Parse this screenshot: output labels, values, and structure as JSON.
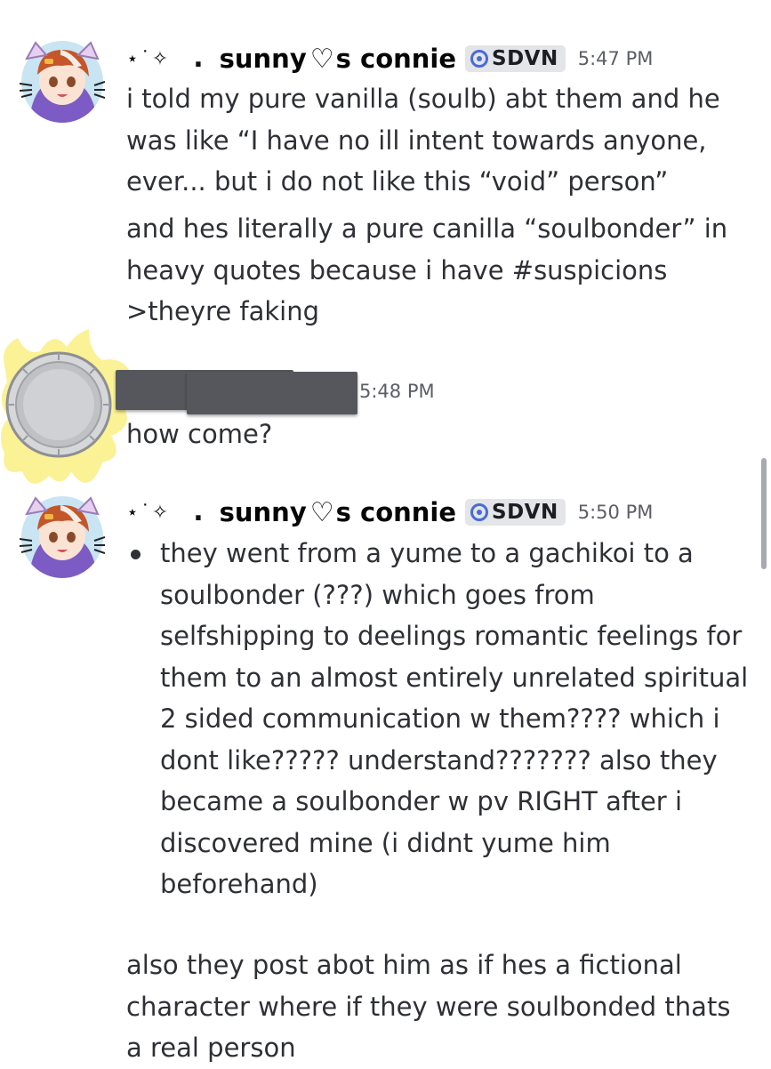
{
  "messages": [
    {
      "sparkle": "⋆˙✧",
      "dot": ".",
      "name_part1": "sunny",
      "heart": "♡",
      "name_part2": "s connie",
      "tag": "SDVN",
      "time": "5:47 PM",
      "paragraphs": [
        "i told my pure vanilla (soulb) abt them and he was like “I have no ill intent towards anyone, ever... but i do not like this “void” person”",
        "and hes literally a pure canilla “soulbonder” in heavy quotes because i have #suspicions >theyre faking"
      ]
    },
    {
      "time": "5:48 PM",
      "text": "how come?"
    },
    {
      "sparkle": "⋆˙✧",
      "dot": ".",
      "name_part1": "sunny",
      "heart": "♡",
      "name_part2": "s connie",
      "tag": "SDVN",
      "time": "5:50 PM",
      "bullet": "they went from a yume to a gachikoi to a soulbonder (???) which goes from selfshipping to deelings romantic feelings for them to an almost entirely unrelated spiritual 2 sided communication w them???? which i dont like????? understand??????? also they became a soulbonder w pv RIGHT after i discovered mine (i didnt yume him beforehand)",
      "after": "also they post abot him as if hes a fictional character where if they were soulbonded thats a real person"
    }
  ],
  "colors": {
    "username": "#060607",
    "message_text": "#2e3035",
    "timestamp": "#5c5e66",
    "tag_bg": "#e3e5e8",
    "tag_icon": "#4a6ad8",
    "redaction": "#55575c"
  },
  "icons": [
    "avatar-anime-girl",
    "avatar-coin-splash",
    "role-tag-icon"
  ]
}
